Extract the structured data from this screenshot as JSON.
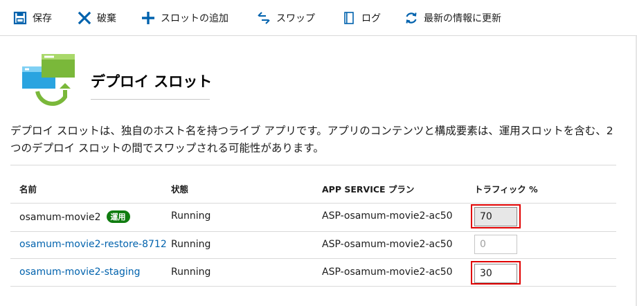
{
  "toolbar": {
    "save": "保存",
    "discard": "破棄",
    "add_slot": "スロットの追加",
    "swap": "スワップ",
    "log": "ログ",
    "refresh": "最新の情報に更新"
  },
  "icons": {
    "save": "save-icon",
    "discard": "x-icon",
    "add": "plus-icon",
    "swap": "swap-icon",
    "log": "log-icon",
    "refresh": "refresh-icon"
  },
  "colors": {
    "accent": "#0062ad",
    "badge": "#107c10",
    "highlight": "#e00000"
  },
  "page": {
    "title": "デプロイ スロット",
    "description": "デプロイ スロットは、独自のホスト名を持つライブ アプリです。アプリのコンテンツと構成要素は、運用スロットを含む、2 つのデプロイ スロットの間でスワップされる可能性があります。"
  },
  "table": {
    "headers": {
      "name": "名前",
      "status": "状態",
      "plan": "APP SERVICE プラン",
      "traffic": "トラフィック %"
    },
    "rows": [
      {
        "name": "osamum-movie2",
        "badge": "運用",
        "status": "Running",
        "plan": "ASP-osamum-movie2-ac50",
        "traffic": "70"
      },
      {
        "name": "osamum-movie2-restore-8712",
        "status": "Running",
        "plan": "ASP-osamum-movie2-ac50",
        "traffic": "0"
      },
      {
        "name": "osamum-movie2-staging",
        "status": "Running",
        "plan": "ASP-osamum-movie2-ac50",
        "traffic": "30"
      }
    ]
  }
}
